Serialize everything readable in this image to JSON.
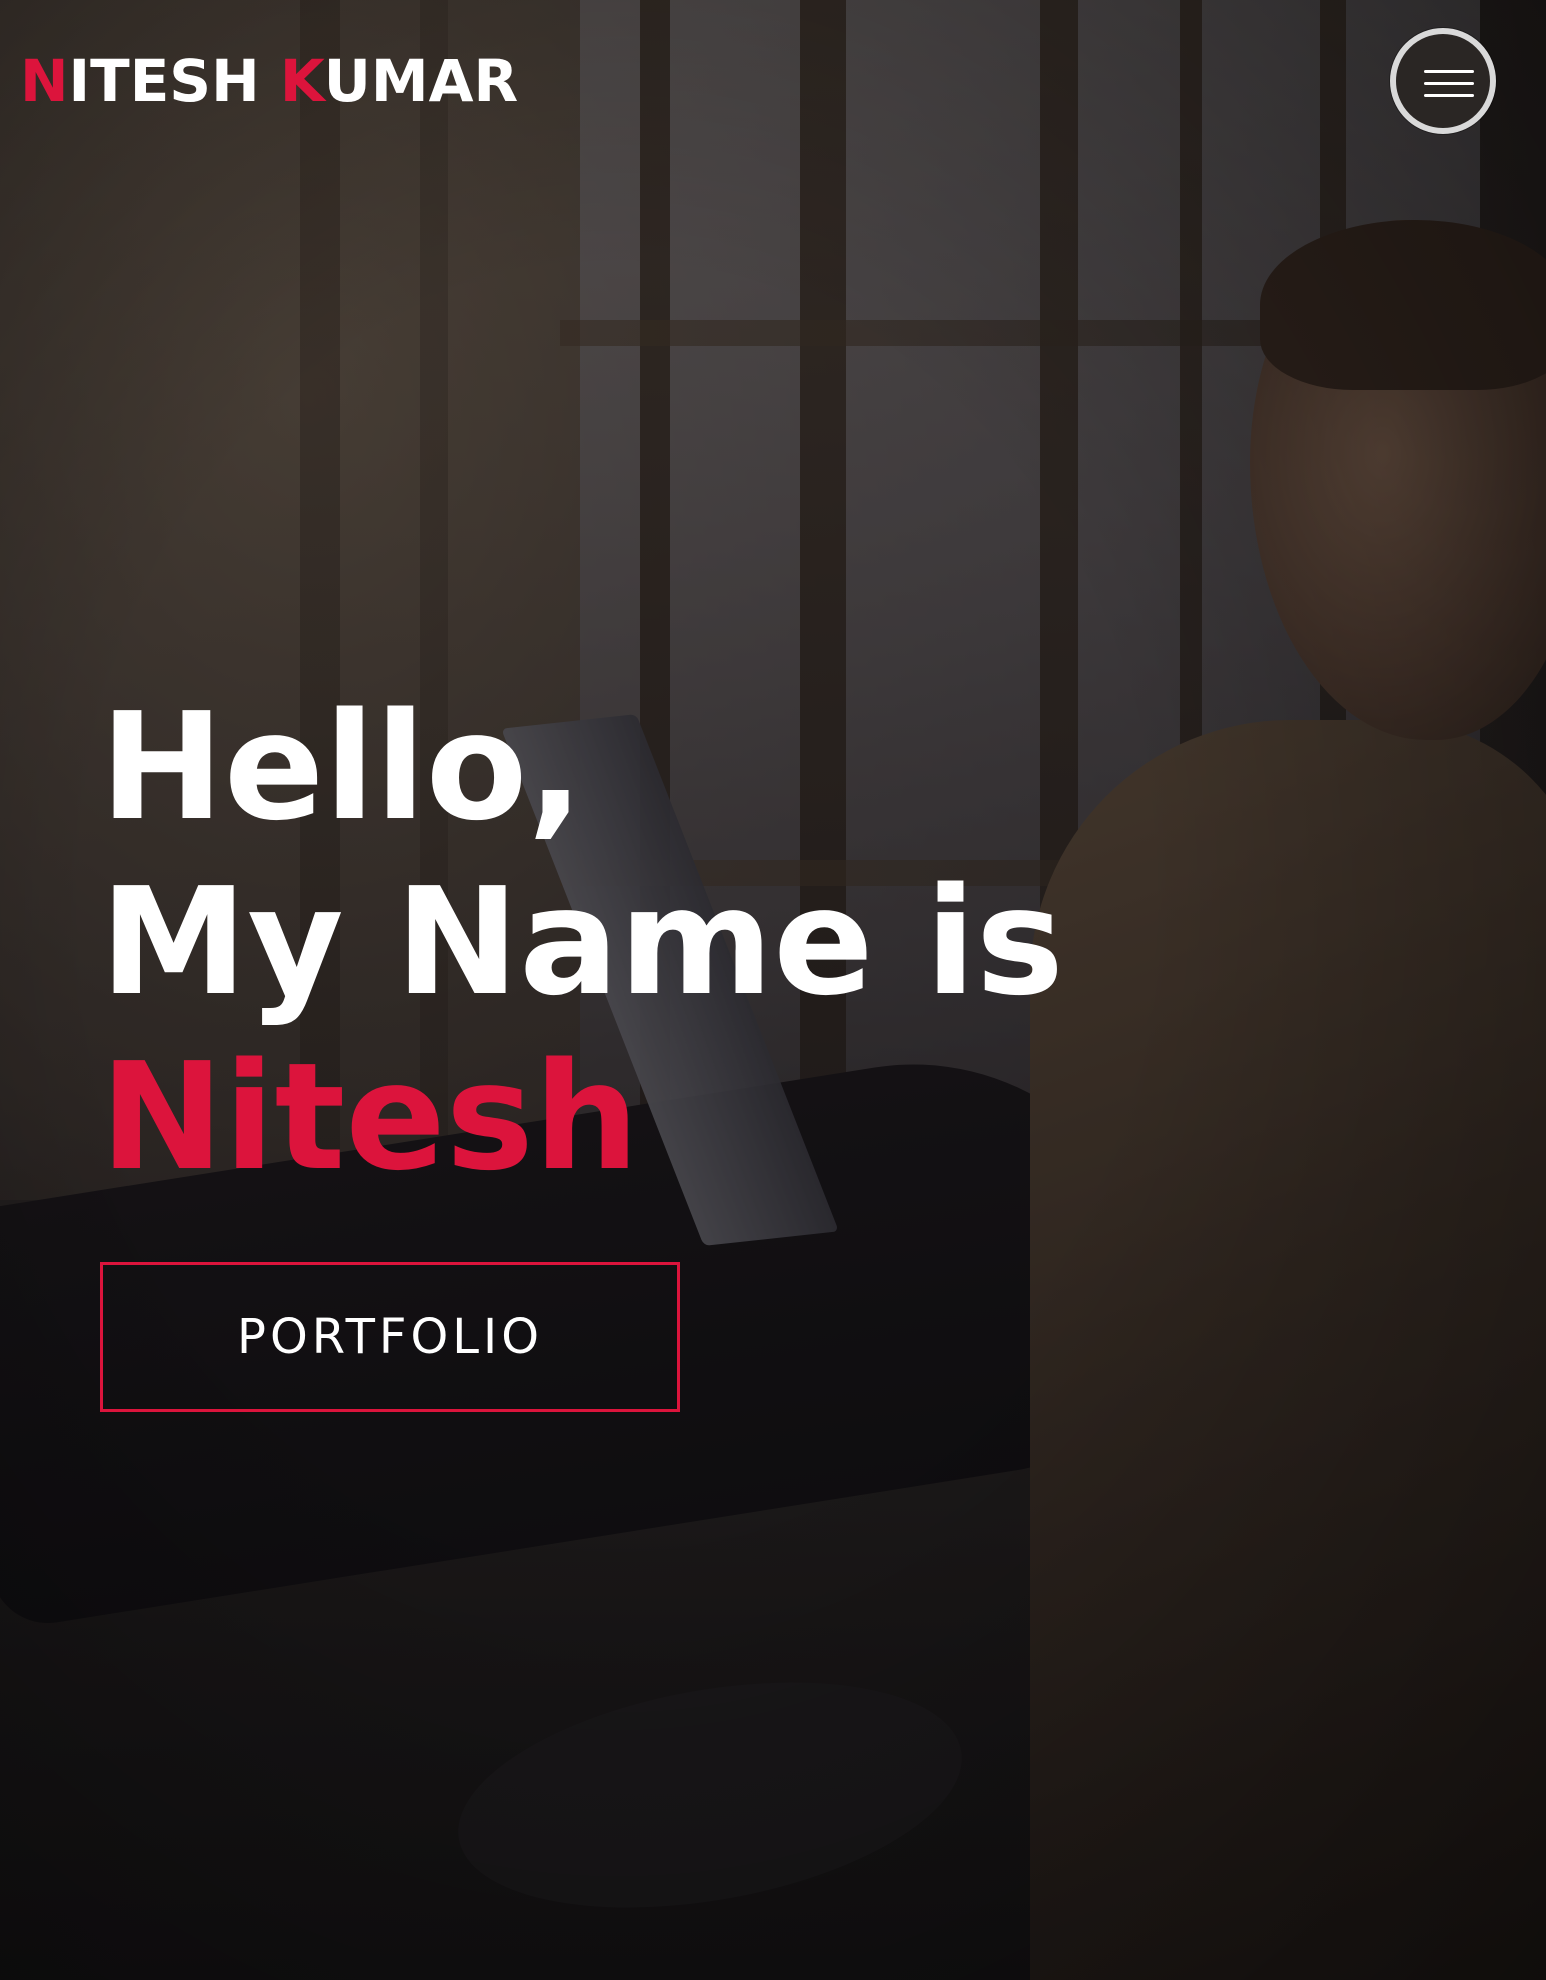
{
  "header": {
    "logo": {
      "first_initial": "N",
      "first_rest": "ITESH",
      "last_initial": "K",
      "last_rest": "UMAR"
    },
    "menu_icon": "hamburger-menu-icon"
  },
  "hero": {
    "greeting": "Hello,",
    "intro": "My Name is",
    "name": "Nitesh",
    "cta_label": "PORTFOLIO"
  },
  "colors": {
    "accent": "#dc143c",
    "text": "#ffffff",
    "menu_ring": "#d9d9d9"
  }
}
